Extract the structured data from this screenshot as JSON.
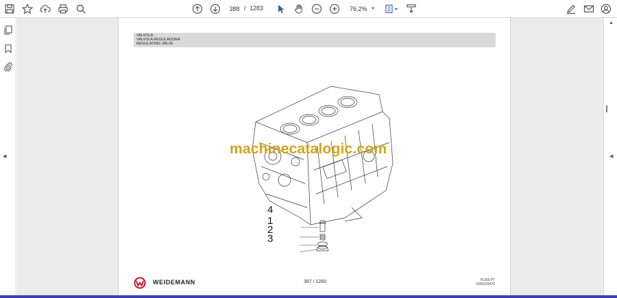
{
  "toolbar": {
    "icons": [
      "save-icon",
      "bookmark-star-icon",
      "upload-cloud-icon",
      "print-icon",
      "zoom-search-icon",
      "arrow-up-circle-icon",
      "arrow-down-circle-icon",
      "select-cursor-icon",
      "hand-pan-icon",
      "zoom-out-icon",
      "zoom-in-icon",
      "fit-page-icon",
      "scroll-mode-icon",
      "fill-sign-icon",
      "email-icon",
      "account-icon"
    ],
    "page_current": "388",
    "page_separator": "/",
    "page_total": "1283",
    "zoom_value": "76,2%"
  },
  "sidebar": {
    "icons": [
      "pages-thumbnail-icon",
      "bookmark-icon",
      "attachment-icon"
    ]
  },
  "document": {
    "title_lines": [
      "VALVOLA",
      "VALVULA REGULADORA",
      "REGULATING VALVE"
    ],
    "watermark": "machinecatalogic.com",
    "callouts": [
      {
        "number": "4"
      },
      {
        "number": "1"
      },
      {
        "number": "2"
      },
      {
        "number": "3"
      }
    ],
    "footer_brand": "WEIDEMANN",
    "footer_page": "387 / 1280",
    "footer_code_1": "RL80LPT",
    "footer_code_2": "1000329476"
  },
  "colors": {
    "accent_strip": "#3c3cbd",
    "watermark": "#d4a21a",
    "viewer_background": "#ebebeb",
    "titlebar_background": "#d9d9d9",
    "logo_red": "#c8102e"
  }
}
